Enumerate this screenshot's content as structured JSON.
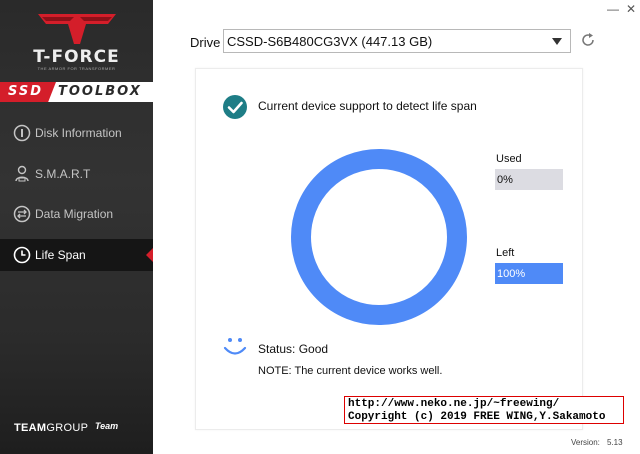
{
  "sidebar": {
    "logo_text": "T-FORCE",
    "logo_tagline": "THE ARMOR FOR TRANSFORMER",
    "banner_left": "SSD",
    "banner_right": "TOOLBOX",
    "items": [
      {
        "label": "Disk Information",
        "icon": "disk-info-icon",
        "active": false
      },
      {
        "label": "S.M.A.R.T",
        "icon": "smart-user-icon",
        "active": false
      },
      {
        "label": "Data Migration",
        "icon": "migration-icon",
        "active": false
      },
      {
        "label": "Life Span",
        "icon": "clock-icon",
        "active": true
      }
    ],
    "brand_bold": "TEAM",
    "brand_thin": "GROUP",
    "brand_mark": "Team"
  },
  "window": {
    "minimize": "—",
    "close": "✕"
  },
  "drive": {
    "label": "Drive",
    "value": "CSSD-S6B480CG3VX (447.13 GB)"
  },
  "lifespan": {
    "support_text": "Current device support to detect life span",
    "used_label": "Used",
    "used_value": "0%",
    "left_label": "Left",
    "left_value": "100%",
    "used_fraction": 0,
    "status_text": "Status: Good",
    "note_text": "NOTE: The current device works well."
  },
  "version": {
    "label": "Version:",
    "value": "5.13"
  },
  "overlay": {
    "line1": "http://www.neko.ne.jp/~freewing/",
    "line2": "Copyright (c) 2019 FREE WING,Y.Sakamoto"
  },
  "colors": {
    "accent_blue": "#4f8af7",
    "teal_check": "#1e7d86",
    "brand_red": "#d41e2a",
    "used_gray": "#dcdce2"
  }
}
